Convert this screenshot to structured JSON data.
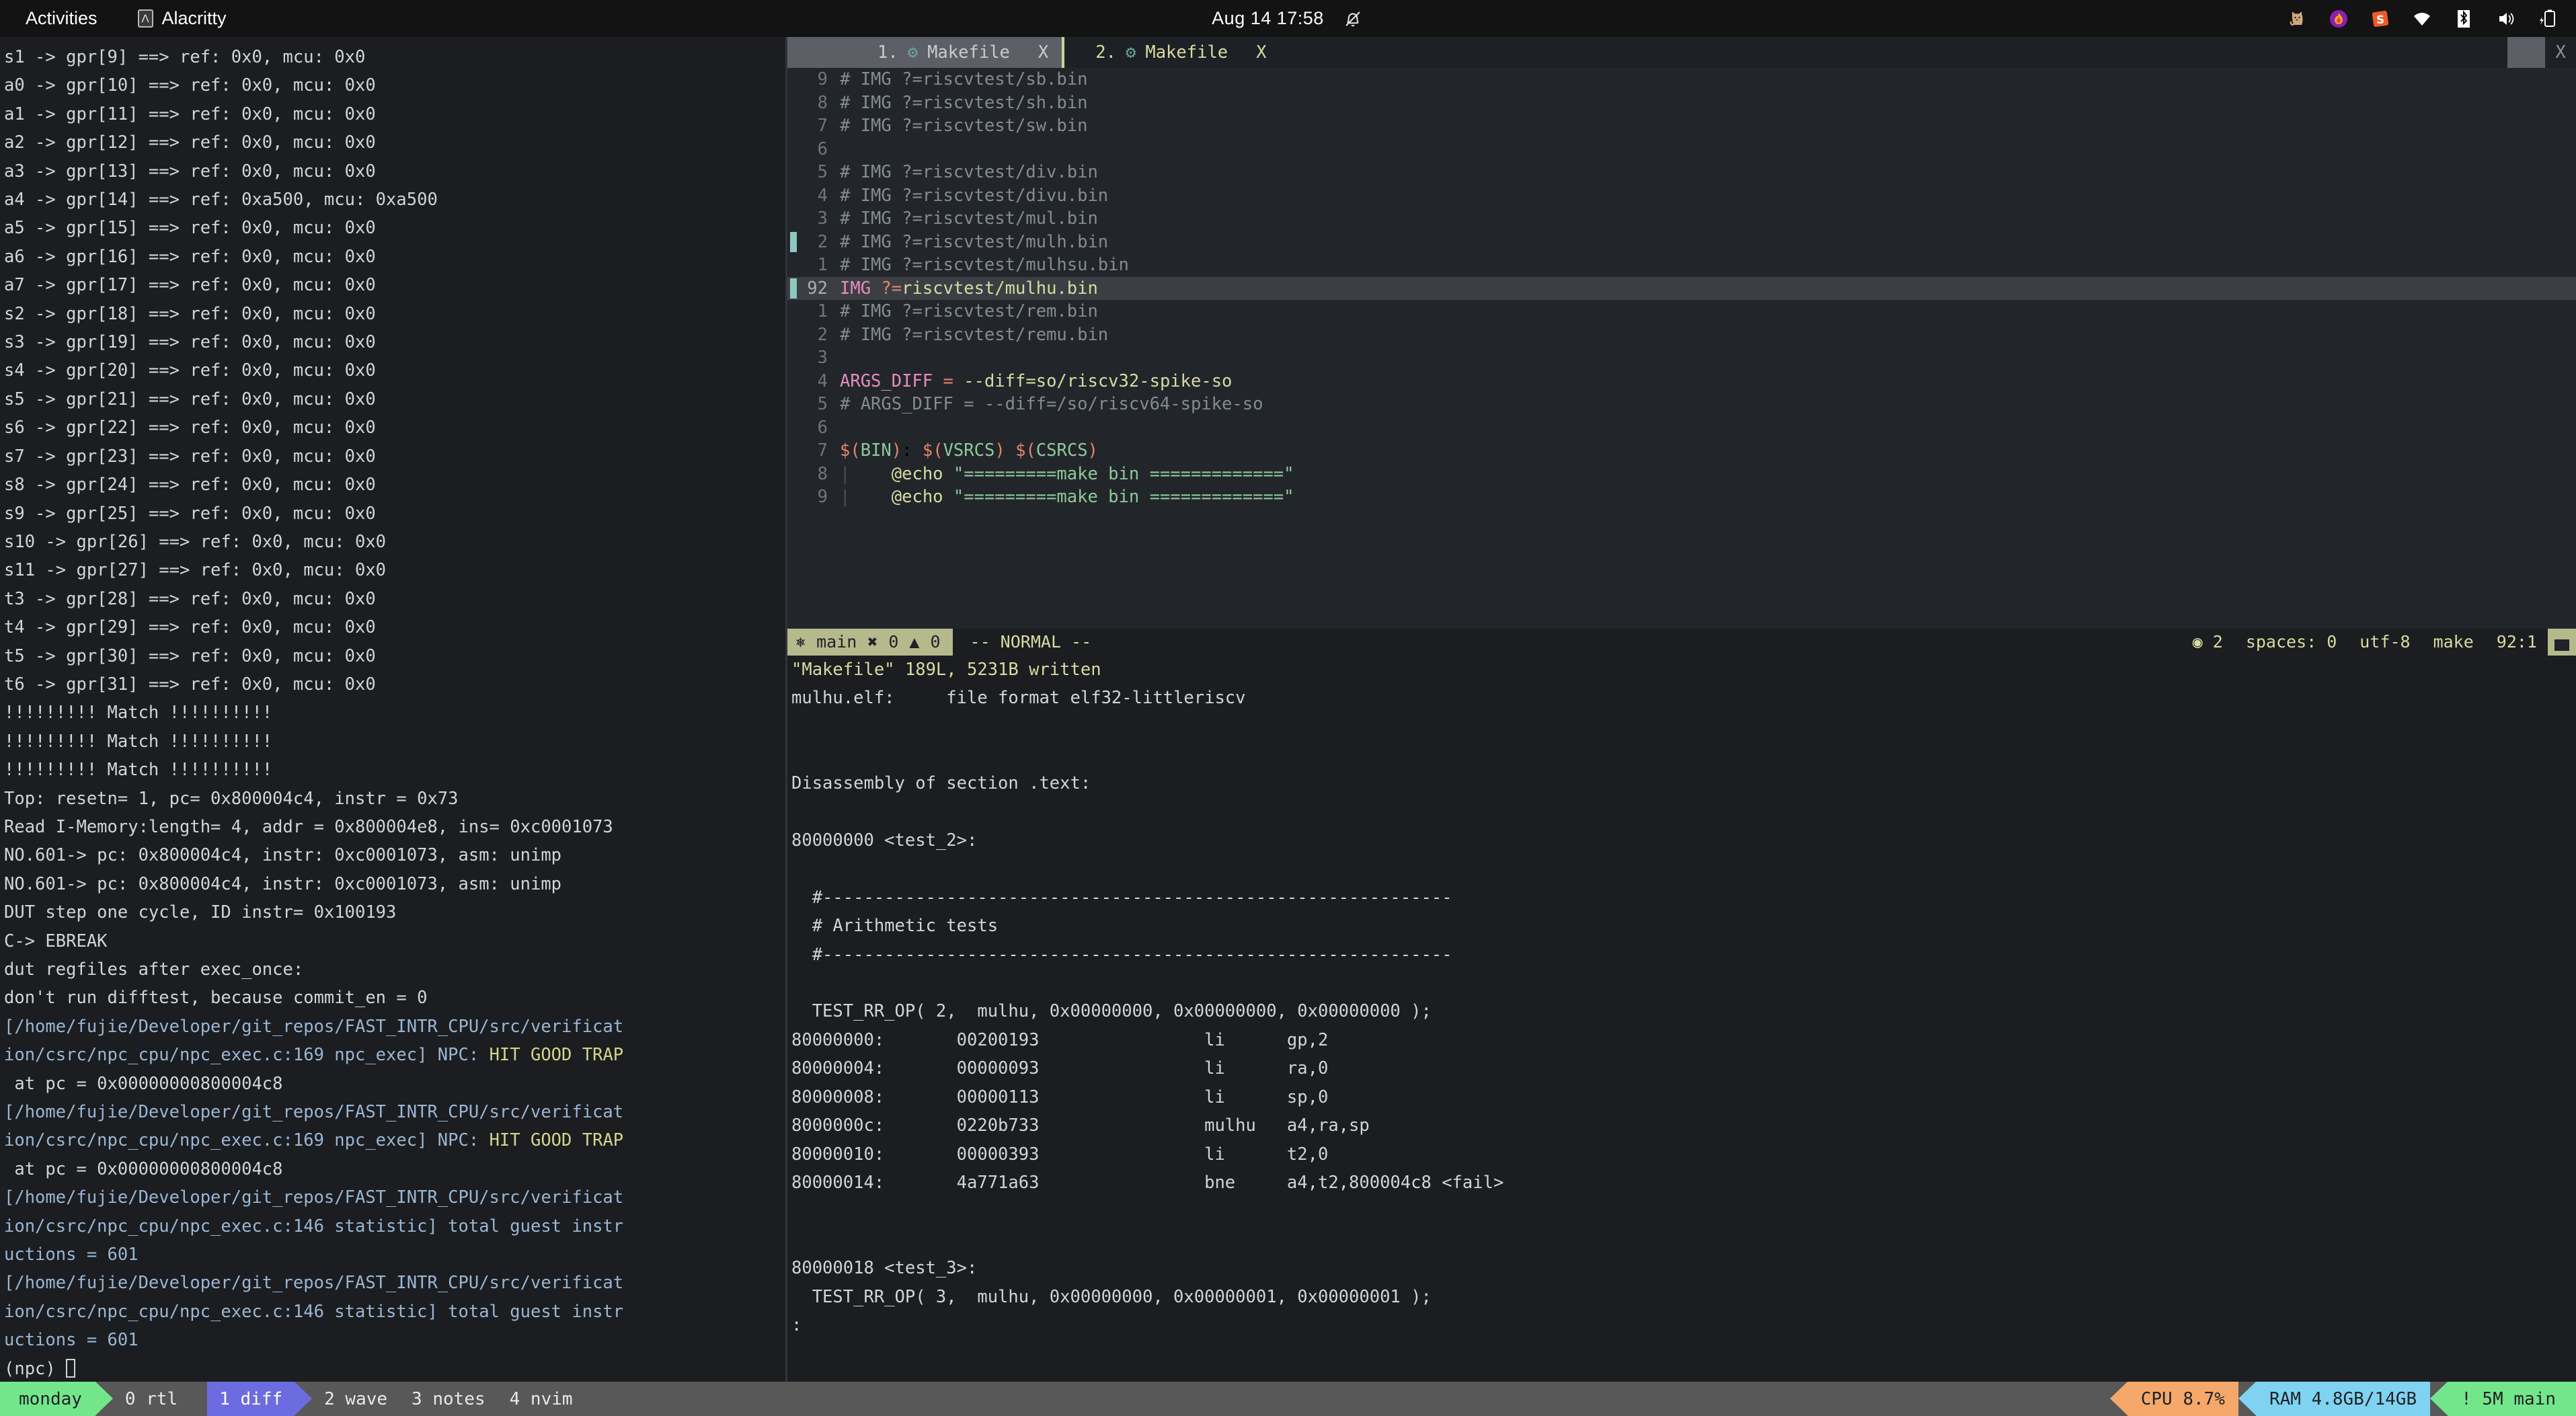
{
  "topbar": {
    "activities": "Activities",
    "app_name": "Alacritty",
    "app_icon": "alacritty-icon",
    "clock": "Aug 14  17:58",
    "notification_icon": "bell-muted-icon",
    "tray": [
      {
        "name": "cat-icon",
        "glyph": "🐱"
      },
      {
        "name": "flame-icon",
        "glyph": "🔥"
      },
      {
        "name": "sublime-s-icon",
        "glyph": "S"
      },
      {
        "name": "wifi-icon",
        "glyph": "▼"
      },
      {
        "name": "bluetooth-icon",
        "glyph": "ᛗ"
      },
      {
        "name": "volume-icon",
        "glyph": "🔊"
      },
      {
        "name": "battery-charging-icon",
        "glyph": "⚡"
      }
    ]
  },
  "left_pane": {
    "lines": [
      "s1 -> gpr[9] ==> ref: 0x0, mcu: 0x0",
      "a0 -> gpr[10] ==> ref: 0x0, mcu: 0x0",
      "a1 -> gpr[11] ==> ref: 0x0, mcu: 0x0",
      "a2 -> gpr[12] ==> ref: 0x0, mcu: 0x0",
      "a3 -> gpr[13] ==> ref: 0x0, mcu: 0x0",
      "a4 -> gpr[14] ==> ref: 0xa500, mcu: 0xa500",
      "a5 -> gpr[15] ==> ref: 0x0, mcu: 0x0",
      "a6 -> gpr[16] ==> ref: 0x0, mcu: 0x0",
      "a7 -> gpr[17] ==> ref: 0x0, mcu: 0x0",
      "s2 -> gpr[18] ==> ref: 0x0, mcu: 0x0",
      "s3 -> gpr[19] ==> ref: 0x0, mcu: 0x0",
      "s4 -> gpr[20] ==> ref: 0x0, mcu: 0x0",
      "s5 -> gpr[21] ==> ref: 0x0, mcu: 0x0",
      "s6 -> gpr[22] ==> ref: 0x0, mcu: 0x0",
      "s7 -> gpr[23] ==> ref: 0x0, mcu: 0x0",
      "s8 -> gpr[24] ==> ref: 0x0, mcu: 0x0",
      "s9 -> gpr[25] ==> ref: 0x0, mcu: 0x0",
      "s10 -> gpr[26] ==> ref: 0x0, mcu: 0x0",
      "s11 -> gpr[27] ==> ref: 0x0, mcu: 0x0",
      "t3 -> gpr[28] ==> ref: 0x0, mcu: 0x0",
      "t4 -> gpr[29] ==> ref: 0x0, mcu: 0x0",
      "t5 -> gpr[30] ==> ref: 0x0, mcu: 0x0",
      "t6 -> gpr[31] ==> ref: 0x0, mcu: 0x0",
      "!!!!!!!!! Match !!!!!!!!!!",
      "!!!!!!!!! Match !!!!!!!!!!",
      "!!!!!!!!! Match !!!!!!!!!!",
      "Top: resetn= 1, pc= 0x800004c4, instr = 0x73",
      "Read I-Memory:length= 4, addr = 0x800004e8, ins= 0xc0001073",
      "NO.601-> pc: 0x800004c4, instr: 0xc0001073, asm: unimp",
      "NO.601-> pc: 0x800004c4, instr: 0xc0001073, asm: unimp",
      "DUT step one cycle, ID instr= 0x100193",
      "C-> EBREAK",
      "dut regfiles after exec_once:",
      "don't run difftest, because commit_en = 0"
    ],
    "trap_blocks": [
      {
        "path1": "[/home/fujie/Developer/git_repos/FAST_INTR_CPU/src/verificat",
        "path2_prefix": "ion/csrc/npc_cpu/npc_exec.c:169 npc_exec] NPC: ",
        "highlight": "HIT GOOD TRAP",
        "line3": " at pc = 0x00000000800004c8"
      },
      {
        "path1": "[/home/fujie/Developer/git_repos/FAST_INTR_CPU/src/verificat",
        "path2_prefix": "ion/csrc/npc_cpu/npc_exec.c:169 npc_exec] NPC: ",
        "highlight": "HIT GOOD TRAP",
        "line3": " at pc = 0x00000000800004c8"
      }
    ],
    "stat_blocks": [
      {
        "path1": "[/home/fujie/Developer/git_repos/FAST_INTR_CPU/src/verificat",
        "path2": "ion/csrc/npc_cpu/npc_exec.c:146 statistic] total guest instr",
        "path3": "uctions = 601"
      },
      {
        "path1": "[/home/fujie/Developer/git_repos/FAST_INTR_CPU/src/verificat",
        "path2": "ion/csrc/npc_cpu/npc_exec.c:146 statistic] total guest instr",
        "path3": "uctions = 601"
      }
    ],
    "prompt": "(npc) "
  },
  "nvim": {
    "tabs": [
      {
        "index": "1.",
        "icon": "gear-icon",
        "label": "Makefile",
        "close": "X",
        "state": "selected"
      },
      {
        "index": "2.",
        "icon": "gear-icon",
        "label": "Makefile",
        "close": "X",
        "state": "current"
      }
    ],
    "tabline_close": "X",
    "buffer_lines": [
      {
        "num": "9",
        "sign": false,
        "abs": false,
        "segments": [
          {
            "c": "comment",
            "t": "# IMG ?=riscvtest/sb.bin"
          }
        ]
      },
      {
        "num": "8",
        "sign": false,
        "abs": false,
        "segments": [
          {
            "c": "comment",
            "t": "# IMG ?=riscvtest/sh.bin"
          }
        ]
      },
      {
        "num": "7",
        "sign": false,
        "abs": false,
        "segments": [
          {
            "c": "comment",
            "t": "# IMG ?=riscvtest/sw.bin"
          }
        ]
      },
      {
        "num": "6",
        "sign": false,
        "abs": false,
        "segments": []
      },
      {
        "num": "5",
        "sign": false,
        "abs": false,
        "segments": [
          {
            "c": "comment",
            "t": "# IMG ?=riscvtest/div.bin"
          }
        ]
      },
      {
        "num": "4",
        "sign": false,
        "abs": false,
        "segments": [
          {
            "c": "comment",
            "t": "# IMG ?=riscvtest/divu.bin"
          }
        ]
      },
      {
        "num": "3",
        "sign": false,
        "abs": false,
        "segments": [
          {
            "c": "comment",
            "t": "# IMG ?=riscvtest/mul.bin"
          }
        ]
      },
      {
        "num": "2",
        "sign": true,
        "abs": false,
        "segments": [
          {
            "c": "comment",
            "t": "# IMG ?=riscvtest/mulh.bin"
          }
        ]
      },
      {
        "num": "1",
        "sign": false,
        "abs": false,
        "segments": [
          {
            "c": "comment",
            "t": "# IMG ?=riscvtest/mulhsu.bin"
          }
        ]
      },
      {
        "num": "92",
        "sign": true,
        "abs": true,
        "cursor": true,
        "segments": [
          {
            "c": "var",
            "t": "IMG"
          },
          {
            "c": "plain",
            "t": " "
          },
          {
            "c": "op",
            "t": "?="
          },
          {
            "c": "str",
            "t": "riscvtest/mulhu.bin"
          }
        ]
      },
      {
        "num": "1",
        "sign": false,
        "abs": false,
        "segments": [
          {
            "c": "comment",
            "t": "# IMG ?=riscvtest/rem.bin"
          }
        ]
      },
      {
        "num": "2",
        "sign": false,
        "abs": false,
        "segments": [
          {
            "c": "comment",
            "t": "# IMG ?=riscvtest/remu.bin"
          }
        ]
      },
      {
        "num": "3",
        "sign": false,
        "abs": false,
        "segments": []
      },
      {
        "num": "4",
        "sign": false,
        "abs": false,
        "segments": [
          {
            "c": "var",
            "t": "ARGS_DIFF"
          },
          {
            "c": "plain",
            "t": " "
          },
          {
            "c": "op",
            "t": "="
          },
          {
            "c": "plain",
            "t": " "
          },
          {
            "c": "str",
            "t": "--diff=so/riscv32-spike-so"
          }
        ]
      },
      {
        "num": "5",
        "sign": false,
        "abs": false,
        "segments": [
          {
            "c": "comment",
            "t": "# ARGS_DIFF = --diff=/so/riscv64-spike-so"
          }
        ]
      },
      {
        "num": "6",
        "sign": false,
        "abs": false,
        "segments": []
      },
      {
        "num": "7",
        "sign": false,
        "abs": false,
        "segments": [
          {
            "c": "target",
            "t": "$("
          },
          {
            "c": "func",
            "t": "BIN"
          },
          {
            "c": "target",
            "t": ")"
          },
          {
            "c": "plain",
            "t": ": "
          },
          {
            "c": "target",
            "t": "$("
          },
          {
            "c": "func",
            "t": "VSRCS"
          },
          {
            "c": "target",
            "t": ")"
          },
          {
            "c": "plain",
            "t": " "
          },
          {
            "c": "target",
            "t": "$("
          },
          {
            "c": "func",
            "t": "CSRCS"
          },
          {
            "c": "target",
            "t": ")"
          }
        ]
      },
      {
        "num": "8",
        "sign": false,
        "abs": false,
        "indent": true,
        "segments": [
          {
            "c": "cmd",
            "t": "    @echo "
          },
          {
            "c": "green",
            "t": "\"=========make bin =============\""
          }
        ]
      },
      {
        "num": "9",
        "sign": false,
        "abs": false,
        "indent": true,
        "segments": [
          {
            "c": "cmd",
            "t": "    @echo "
          },
          {
            "c": "green",
            "t": "\"=========make bin =============\""
          }
        ]
      }
    ],
    "statusline": {
      "branch_icon": "git-branch-icon",
      "branch": "main",
      "error_icon": "error-icon",
      "error_count": "0",
      "warn_icon": "warning-icon",
      "warn_count": "0",
      "mode": "-- NORMAL --",
      "buffer_icon": "buffer-icon",
      "buffer_num": "2",
      "spaces": "spaces: 0",
      "encoding": "utf-8",
      "filetype": "make",
      "position": "92:1"
    },
    "message": "\"Makefile\" 189L, 5231B written"
  },
  "disassembly": {
    "lines": [
      "mulhu.elf:     file format elf32-littleriscv",
      "",
      "",
      "Disassembly of section .text:",
      "",
      "80000000 <test_2>:",
      "",
      "  #-------------------------------------------------------------",
      "  # Arithmetic tests",
      "  #-------------------------------------------------------------",
      "",
      "  TEST_RR_OP( 2,  mulhu, 0x00000000, 0x00000000, 0x00000000 );",
      "80000000:       00200193                li      gp,2",
      "80000004:       00000093                li      ra,0",
      "80000008:       00000113                li      sp,0",
      "8000000c:       0220b733                mulhu   a4,ra,sp",
      "80000010:       00000393                li      t2,0",
      "80000014:       4a771a63                bne     a4,t2,800004c8 <fail>",
      "",
      "",
      "80000018 <test_3>:",
      "  TEST_RR_OP( 3,  mulhu, 0x00000000, 0x00000001, 0x00000001 );",
      ":"
    ]
  },
  "tmux": {
    "session": "monday",
    "windows": [
      {
        "label": "0 rtl",
        "active": false
      },
      {
        "label": "1 diff",
        "active": true
      },
      {
        "label": "2 wave",
        "active": false
      },
      {
        "label": "3 notes",
        "active": false
      },
      {
        "label": "4 nvim",
        "active": false
      }
    ],
    "cpu": "CPU  8.7%",
    "ram": "RAM 4.8GB/14GB",
    "git": "! 5M main"
  },
  "colors": {
    "bg": "#1b1d20",
    "nvim_bg": "#22262b",
    "accent_green": "#73e68c",
    "accent_purple": "#6c6ce0",
    "accent_orange": "#f5a86a",
    "accent_cyan": "#7fd3f0",
    "status_yellow": "#b5b98c",
    "path_blue": "#9ab6d4",
    "trap_yellow": "#d4d48b"
  }
}
